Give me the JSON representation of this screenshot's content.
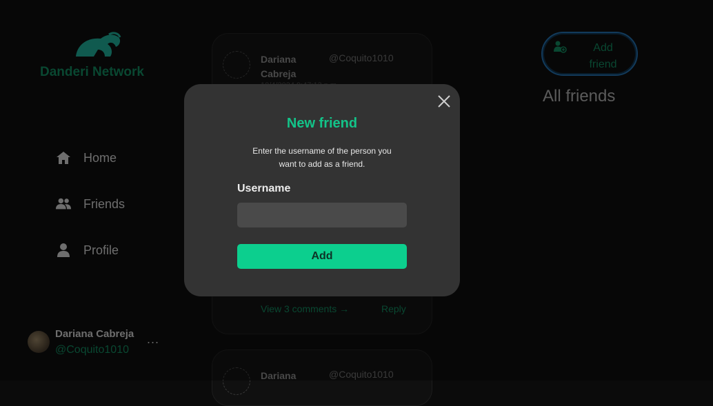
{
  "brand": {
    "name": "Danderi Network",
    "logo_icon": "elephant-icon",
    "color": "#0f6e4c"
  },
  "nav": [
    {
      "label": "Home",
      "icon": "home-icon"
    },
    {
      "label": "Friends",
      "icon": "friends-icon"
    },
    {
      "label": "Profile",
      "icon": "profile-icon"
    }
  ],
  "user": {
    "name": "Dariana Cabreja",
    "handle": "@Coquito1010",
    "more": "..."
  },
  "posts": [
    {
      "author": "Dariana Cabreja",
      "handle": "@Coquito1010",
      "date": "10/4/2024 9:47:13 p.m.",
      "comments_link": "View 3 comments →",
      "reply": "Reply"
    },
    {
      "author": "Dariana",
      "handle": "@Coquito1010"
    }
  ],
  "right": {
    "add_friend": "Add friend",
    "all_friends": "All friends"
  },
  "modal": {
    "title": "New friend",
    "description": "Enter the username of the person you want to add as a friend.",
    "field_label": "Username",
    "field_value": "",
    "submit": "Add",
    "accent": "#0ccf8e"
  }
}
